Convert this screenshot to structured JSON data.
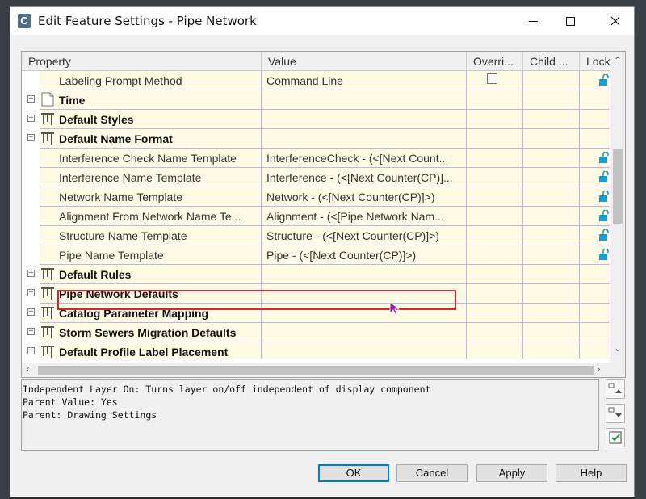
{
  "window": {
    "title": "Edit Feature Settings - Pipe Network",
    "app_icon_letter": "C"
  },
  "grid": {
    "columns": [
      "Property",
      "Value",
      "Overri...",
      "Child ...",
      "Lock"
    ],
    "rows": [
      {
        "kind": "property",
        "label": "Labeling Prompt Method",
        "value": "Command Line",
        "override_checkbox": true,
        "lock": true
      },
      {
        "kind": "category",
        "label": "Time",
        "expander": "+",
        "icon": "document-icon"
      },
      {
        "kind": "category",
        "label": "Default Styles",
        "expander": "+",
        "icon": "pipe-network-icon"
      },
      {
        "kind": "category",
        "label": "Default Name Format",
        "expander": "−",
        "icon": "pipe-network-icon"
      },
      {
        "kind": "property",
        "label": "Interference Check Name Template",
        "value": "InterferenceCheck - (<[Next Count...",
        "lock": true
      },
      {
        "kind": "property",
        "label": "Interference Name Template",
        "value": "Interference - (<[Next Counter(CP)]...",
        "lock": true
      },
      {
        "kind": "property",
        "label": "Network Name Template",
        "value": "Network - (<[Next Counter(CP)]>)",
        "lock": true
      },
      {
        "kind": "property",
        "label": "Alignment From Network Name Te...",
        "value": "Alignment - (<[Pipe Network Nam...",
        "lock": true
      },
      {
        "kind": "property",
        "label": "Structure Name Template",
        "value": "Structure - (<[Next Counter(CP)]>)",
        "lock": true
      },
      {
        "kind": "property",
        "label": "Pipe Name Template",
        "value": "Pipe - (<[Next Counter(CP)]>)",
        "lock": true,
        "highlighted": true
      },
      {
        "kind": "category",
        "label": "Default Rules",
        "expander": "+",
        "icon": "pipe-network-icon"
      },
      {
        "kind": "category",
        "label": "Pipe Network Defaults",
        "expander": "+",
        "icon": "pipe-network-icon"
      },
      {
        "kind": "category",
        "label": "Catalog Parameter Mapping",
        "expander": "+",
        "icon": "pipe-network-icon"
      },
      {
        "kind": "category",
        "label": "Storm Sewers Migration Defaults",
        "expander": "+",
        "icon": "pipe-network-icon"
      },
      {
        "kind": "category",
        "label": "Default Profile Label Placement",
        "expander": "+",
        "icon": "pipe-network-icon"
      }
    ]
  },
  "description": {
    "lines": [
      "Independent Layer On: Turns layer on/off independent of display component",
      "Parent Value: Yes",
      "Parent: Drawing Settings"
    ]
  },
  "side_buttons": [
    "move-up-icon",
    "move-down-icon",
    "checklist-icon"
  ],
  "buttons": {
    "ok": "OK",
    "cancel": "Cancel",
    "apply": "Apply",
    "help": "Help"
  },
  "colors": {
    "row_background": "#fdfbe3",
    "grid_lines": "#c9b0e6",
    "highlight_box": "#e0242f",
    "lock_icon": "#1a9dc9",
    "default_button_border": "#0078d7"
  }
}
